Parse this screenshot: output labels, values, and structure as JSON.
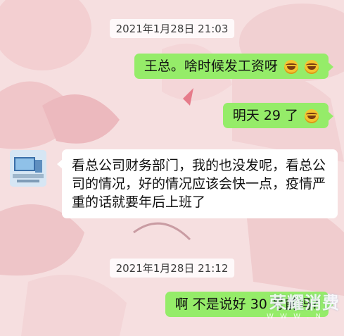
{
  "chat": {
    "messages": [
      {
        "type": "time",
        "text": "2021年1月28日 21:03"
      },
      {
        "type": "me",
        "text": "王总。啥时候发工资呀",
        "emoji": [
          "laugh-cry-icon",
          "laugh-cry-icon"
        ]
      },
      {
        "type": "me",
        "text": "明天 29 了",
        "emoji": [
          "laugh-cry-icon"
        ]
      },
      {
        "type": "other",
        "text": "看总公司财务部门，我的也没发呢，看总公司的情况，好的情况应该会快一点，疫情严重的话就要年后上班了"
      },
      {
        "type": "time",
        "text": "2021年1月28日 21:12"
      },
      {
        "type": "me",
        "text": "啊 不是说好 30 号前吗?"
      }
    ]
  },
  "watermark": {
    "text": "荣耀消费",
    "sub": "W W W . N"
  },
  "colors": {
    "my_bubble": "#95ec69",
    "other_bubble": "#ffffff",
    "background": "#f6dfe0"
  }
}
